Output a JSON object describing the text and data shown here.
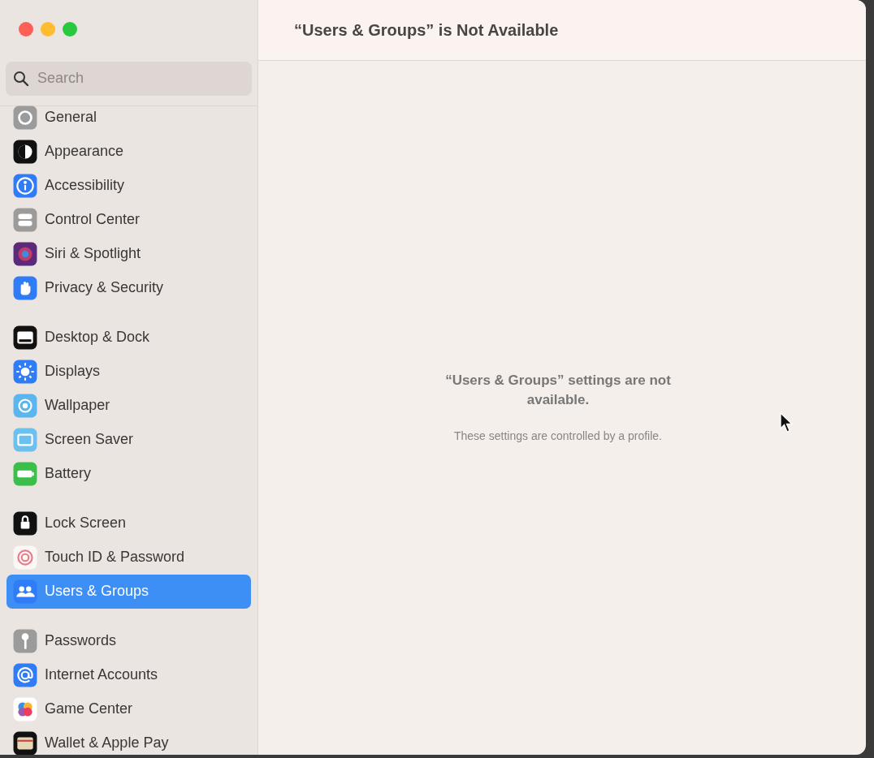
{
  "window": {
    "title": "“Users & Groups” is Not Available"
  },
  "sidebar": {
    "search": {
      "placeholder": "Search"
    },
    "groups": [
      {
        "items": [
          {
            "label": "General",
            "selected": false
          },
          {
            "label": "Appearance",
            "selected": false
          },
          {
            "label": "Accessibility",
            "selected": false
          },
          {
            "label": "Control Center",
            "selected": false
          },
          {
            "label": "Siri & Spotlight",
            "selected": false
          },
          {
            "label": "Privacy & Security",
            "selected": false
          }
        ]
      },
      {
        "items": [
          {
            "label": "Desktop & Dock",
            "selected": false
          },
          {
            "label": "Displays",
            "selected": false
          },
          {
            "label": "Wallpaper",
            "selected": false
          },
          {
            "label": "Screen Saver",
            "selected": false
          },
          {
            "label": "Battery",
            "selected": false
          }
        ]
      },
      {
        "items": [
          {
            "label": "Lock Screen",
            "selected": false
          },
          {
            "label": "Touch ID & Password",
            "selected": false
          },
          {
            "label": "Users & Groups",
            "selected": true
          }
        ]
      },
      {
        "items": [
          {
            "label": "Passwords",
            "selected": false
          },
          {
            "label": "Internet Accounts",
            "selected": false
          },
          {
            "label": "Game Center",
            "selected": false
          },
          {
            "label": "Wallet & Apple Pay",
            "selected": false
          }
        ]
      }
    ]
  },
  "message": {
    "heading": "“Users & Groups” settings are not available.",
    "detail": "These settings are controlled by a profile."
  }
}
